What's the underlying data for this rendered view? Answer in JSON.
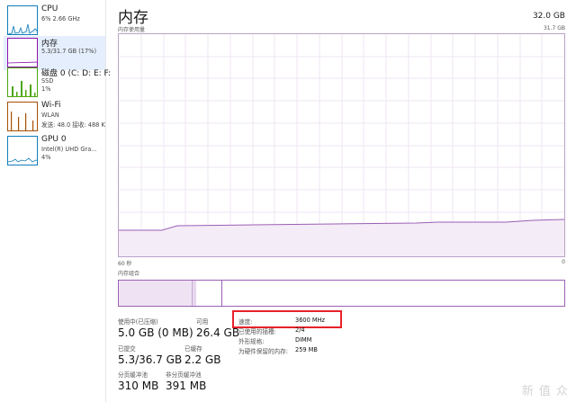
{
  "sidebar": {
    "items": [
      {
        "name": "CPU",
        "sub1": "6% 2.66 GHz",
        "sub2": "",
        "sub3": ""
      },
      {
        "name": "内存",
        "sub1": "5.3/31.7 GB (17%)",
        "sub2": "",
        "sub3": ""
      },
      {
        "name": "磁盘 0 (C: D: E: F:",
        "sub1": "SSD",
        "sub2": "1%",
        "sub3": ""
      },
      {
        "name": "Wi-Fi",
        "sub1": "WLAN",
        "sub2": "发送: 48.0  接收: 488 K",
        "sub3": ""
      },
      {
        "name": "GPU 0",
        "sub1": "Intel(R) UHD Gra...",
        "sub2": "4%",
        "sub3": ""
      }
    ],
    "colors": {
      "cpu": "#117dbb",
      "memory": "#8b12ae",
      "disk": "#4da60c",
      "wifi": "#a74f01",
      "gpu": "#117dbb"
    }
  },
  "main": {
    "title": "内存",
    "total": "32.0 GB",
    "chart_label": "内存使用量",
    "chart_max": "31.7 GB",
    "axis_left": "60 秒",
    "axis_right": "0",
    "composition_label": "内存组合"
  },
  "stats": {
    "in_use_label": "使用中(已压缩)",
    "in_use_value": "5.0 GB (0 MB)",
    "available_label": "可用",
    "available_value": "26.4 GB",
    "committed_label": "已提交",
    "committed_value": "5.3/36.7 GB",
    "cached_label": "已缓存",
    "cached_value": "2.2 GB",
    "paged_label": "分页缓冲池",
    "paged_value": "310 MB",
    "nonpaged_label": "非分页缓冲池",
    "nonpaged_value": "391 MB"
  },
  "details": {
    "speed_label": "速度:",
    "speed_value": "3600 MHz",
    "slots_label": "已使用的插槽:",
    "slots_value": "2/4",
    "form_label": "外形规格:",
    "form_value": "DIMM",
    "reserved_label": "为硬件保留的内存:",
    "reserved_value": "259 MB"
  },
  "watermark": "新 值 众"
}
